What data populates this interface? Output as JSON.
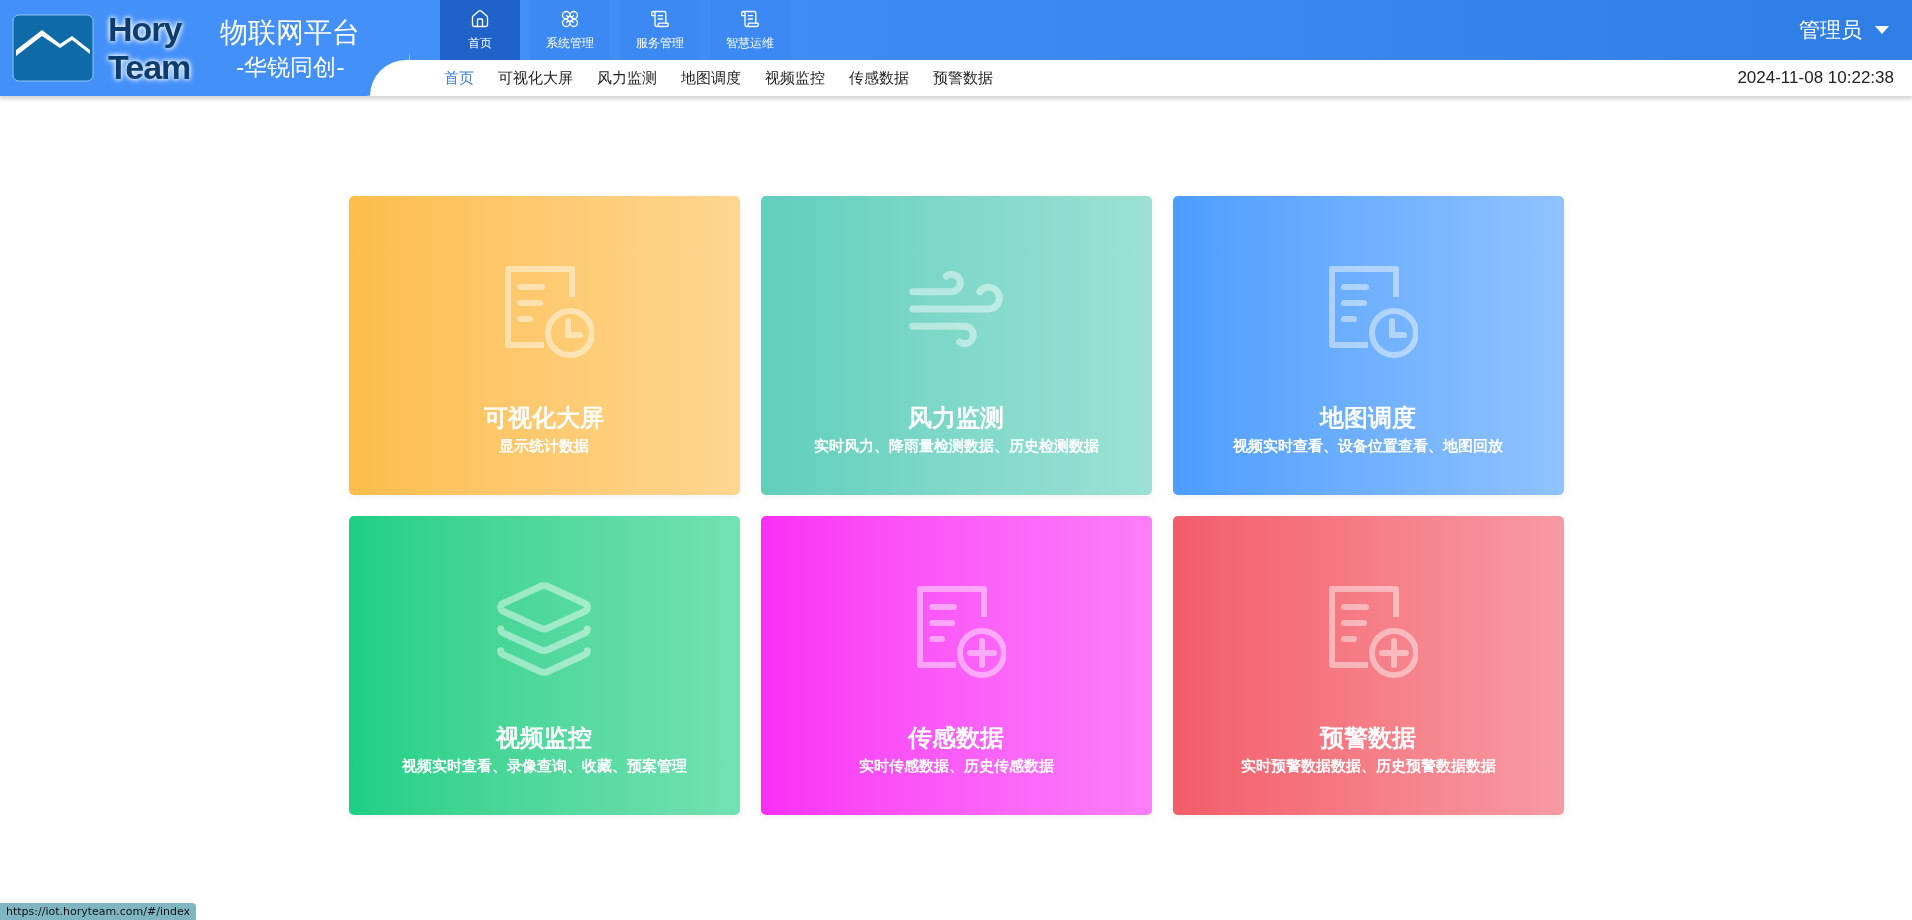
{
  "logo": {
    "word_1": "Hory",
    "word_2": "Team"
  },
  "platform": {
    "title": "物联网平台",
    "subtitle": "-华锐同创-"
  },
  "top_tabs": [
    {
      "label": "首页",
      "kind": "home",
      "selected": true
    },
    {
      "label": "系统管理",
      "kind": "clover",
      "selected": false
    },
    {
      "label": "服务管理",
      "kind": "scroll",
      "selected": false
    },
    {
      "label": "智慧运维",
      "kind": "scroll",
      "selected": false
    }
  ],
  "user_menu": {
    "label": "管理员"
  },
  "sub_nav": [
    {
      "label": "首页",
      "selected": true
    },
    {
      "label": "可视化大屏",
      "selected": false
    },
    {
      "label": "风力监测",
      "selected": false
    },
    {
      "label": "地图调度",
      "selected": false
    },
    {
      "label": "视频监控",
      "selected": false
    },
    {
      "label": "传感数据",
      "selected": false
    },
    {
      "label": "预警数据",
      "selected": false
    }
  ],
  "datetime": "2024-11-08 10:22:38",
  "cards": [
    {
      "title": "可视化大屏",
      "description": "显示统计数据",
      "kind": "doc-clock",
      "color": "#fdbd4b"
    },
    {
      "title": "风力监测",
      "description": "实时风力、降雨量检测数据、历史检测数据",
      "kind": "wind",
      "color": "#5fcfbc"
    },
    {
      "title": "地图调度",
      "description": "视频实时查看、设备位置查看、地图回放",
      "kind": "doc-clock",
      "color": "#4c9dfe"
    },
    {
      "title": "视频监控",
      "description": "视频实时查看、录像查询、收藏、预案管理",
      "kind": "layers",
      "color": "#1bcf85"
    },
    {
      "title": "传感数据",
      "description": "实时传感数据、历史传感数据",
      "kind": "doc-plus",
      "color": "#f92ef5"
    },
    {
      "title": "预警数据",
      "description": "实时预警数据数据、历史预警数据数据",
      "kind": "doc-plus",
      "color": "#f25c6a"
    }
  ],
  "status_link": "https://iot.horyteam.com/#/index"
}
